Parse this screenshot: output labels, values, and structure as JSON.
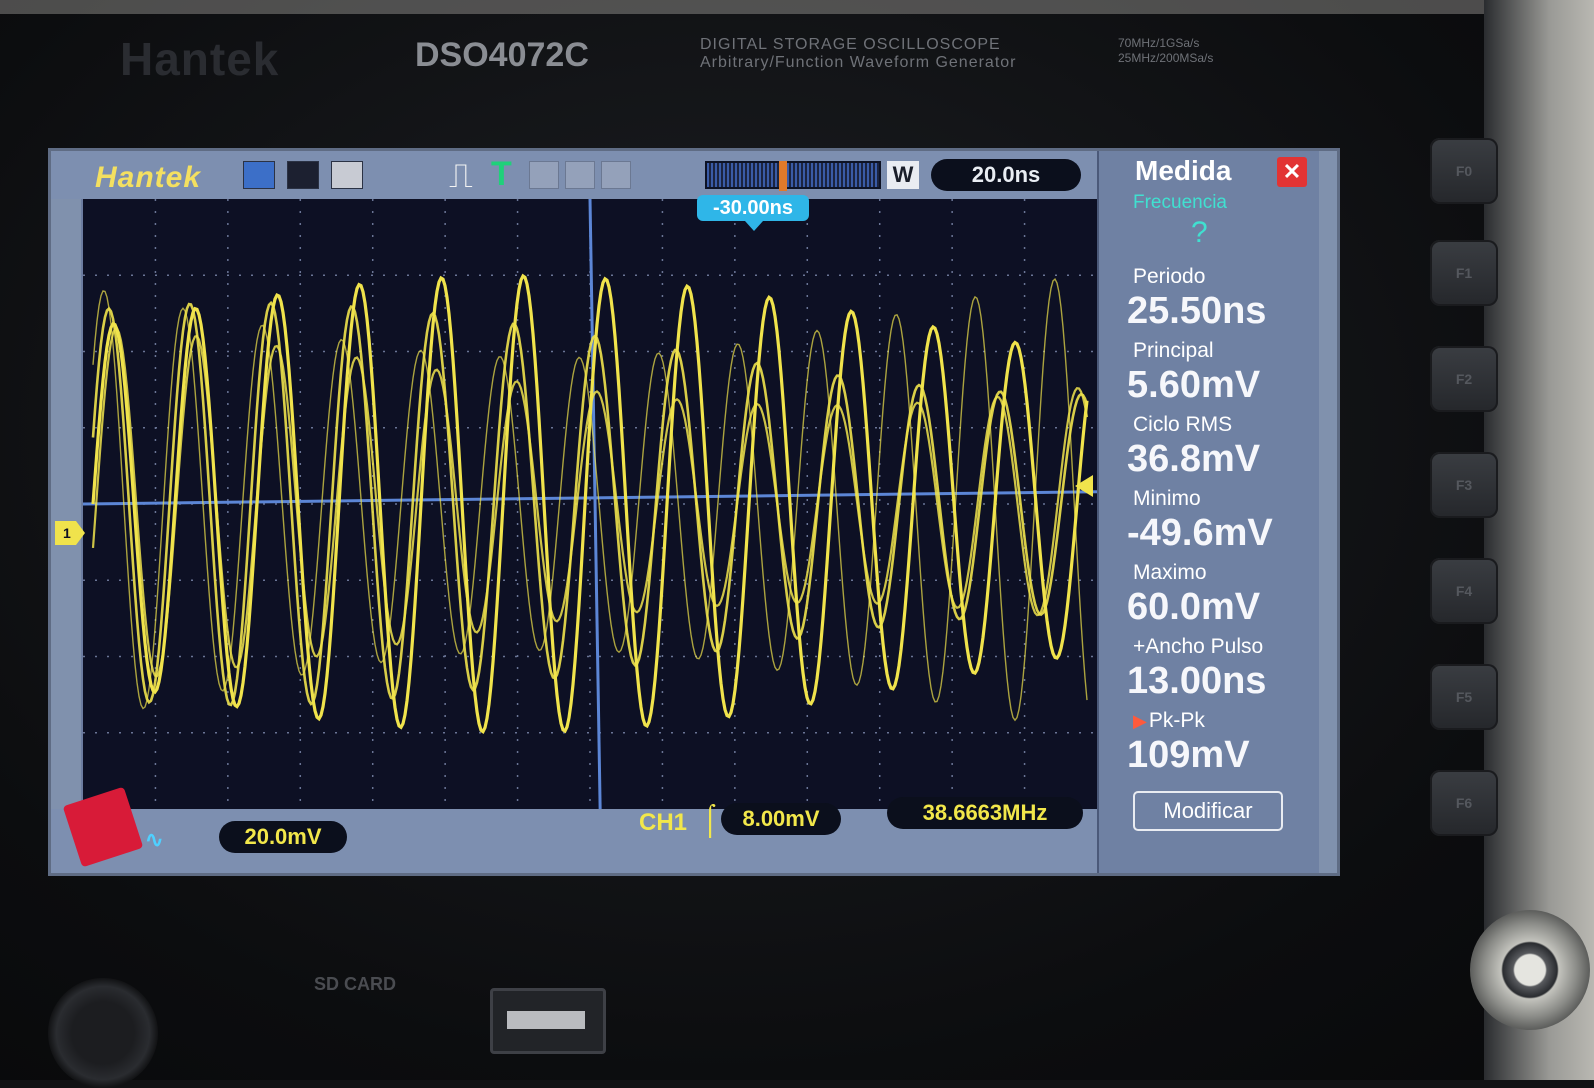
{
  "device": {
    "brand": "Hantek",
    "model": "DSO4072C",
    "subtitle_line1": "DIGITAL STORAGE OSCILLOSCOPE",
    "subtitle_line2": "Arbitrary/Function Waveform Generator",
    "spec_line1": "70MHz/1GSa/s",
    "spec_line2": "25MHz/200MSa/s",
    "sd_label": "SD CARD",
    "fkeys": [
      "F0",
      "F1",
      "F2",
      "F3",
      "F4",
      "F5",
      "F6"
    ]
  },
  "screen": {
    "logo": "Hantek",
    "timebase": "20.0ns",
    "buffer_mode": "W",
    "trigger_position": "-30.00ns",
    "channel_marker": "1",
    "channel_volts_div": "20.0mV",
    "trigger_source": "CH1",
    "trigger_level": "8.00mV",
    "frequency": "38.6663MHz"
  },
  "measure_panel": {
    "title": "Medida",
    "close_label": "✕",
    "first_item_label": "Frecuencia",
    "first_item_value": "?",
    "items": [
      {
        "label": "Periodo",
        "value": "25.50ns"
      },
      {
        "label": "Principal",
        "value": "5.60mV"
      },
      {
        "label": "Ciclo  RMS",
        "value": "36.8mV"
      },
      {
        "label": "Minimo",
        "value": "-49.6mV"
      },
      {
        "label": "Maximo",
        "value": "60.0mV"
      },
      {
        "label": "+Ancho  Pulso",
        "value": "13.00ns"
      },
      {
        "label": "Pk-Pk",
        "value": "109mV"
      }
    ],
    "modify_label": "Modificar"
  },
  "colors": {
    "trace": "#f0e34c",
    "grid_background": "#0d1024",
    "panel": "#6f81a3",
    "accent_cyan": "#2fb6e8"
  }
}
